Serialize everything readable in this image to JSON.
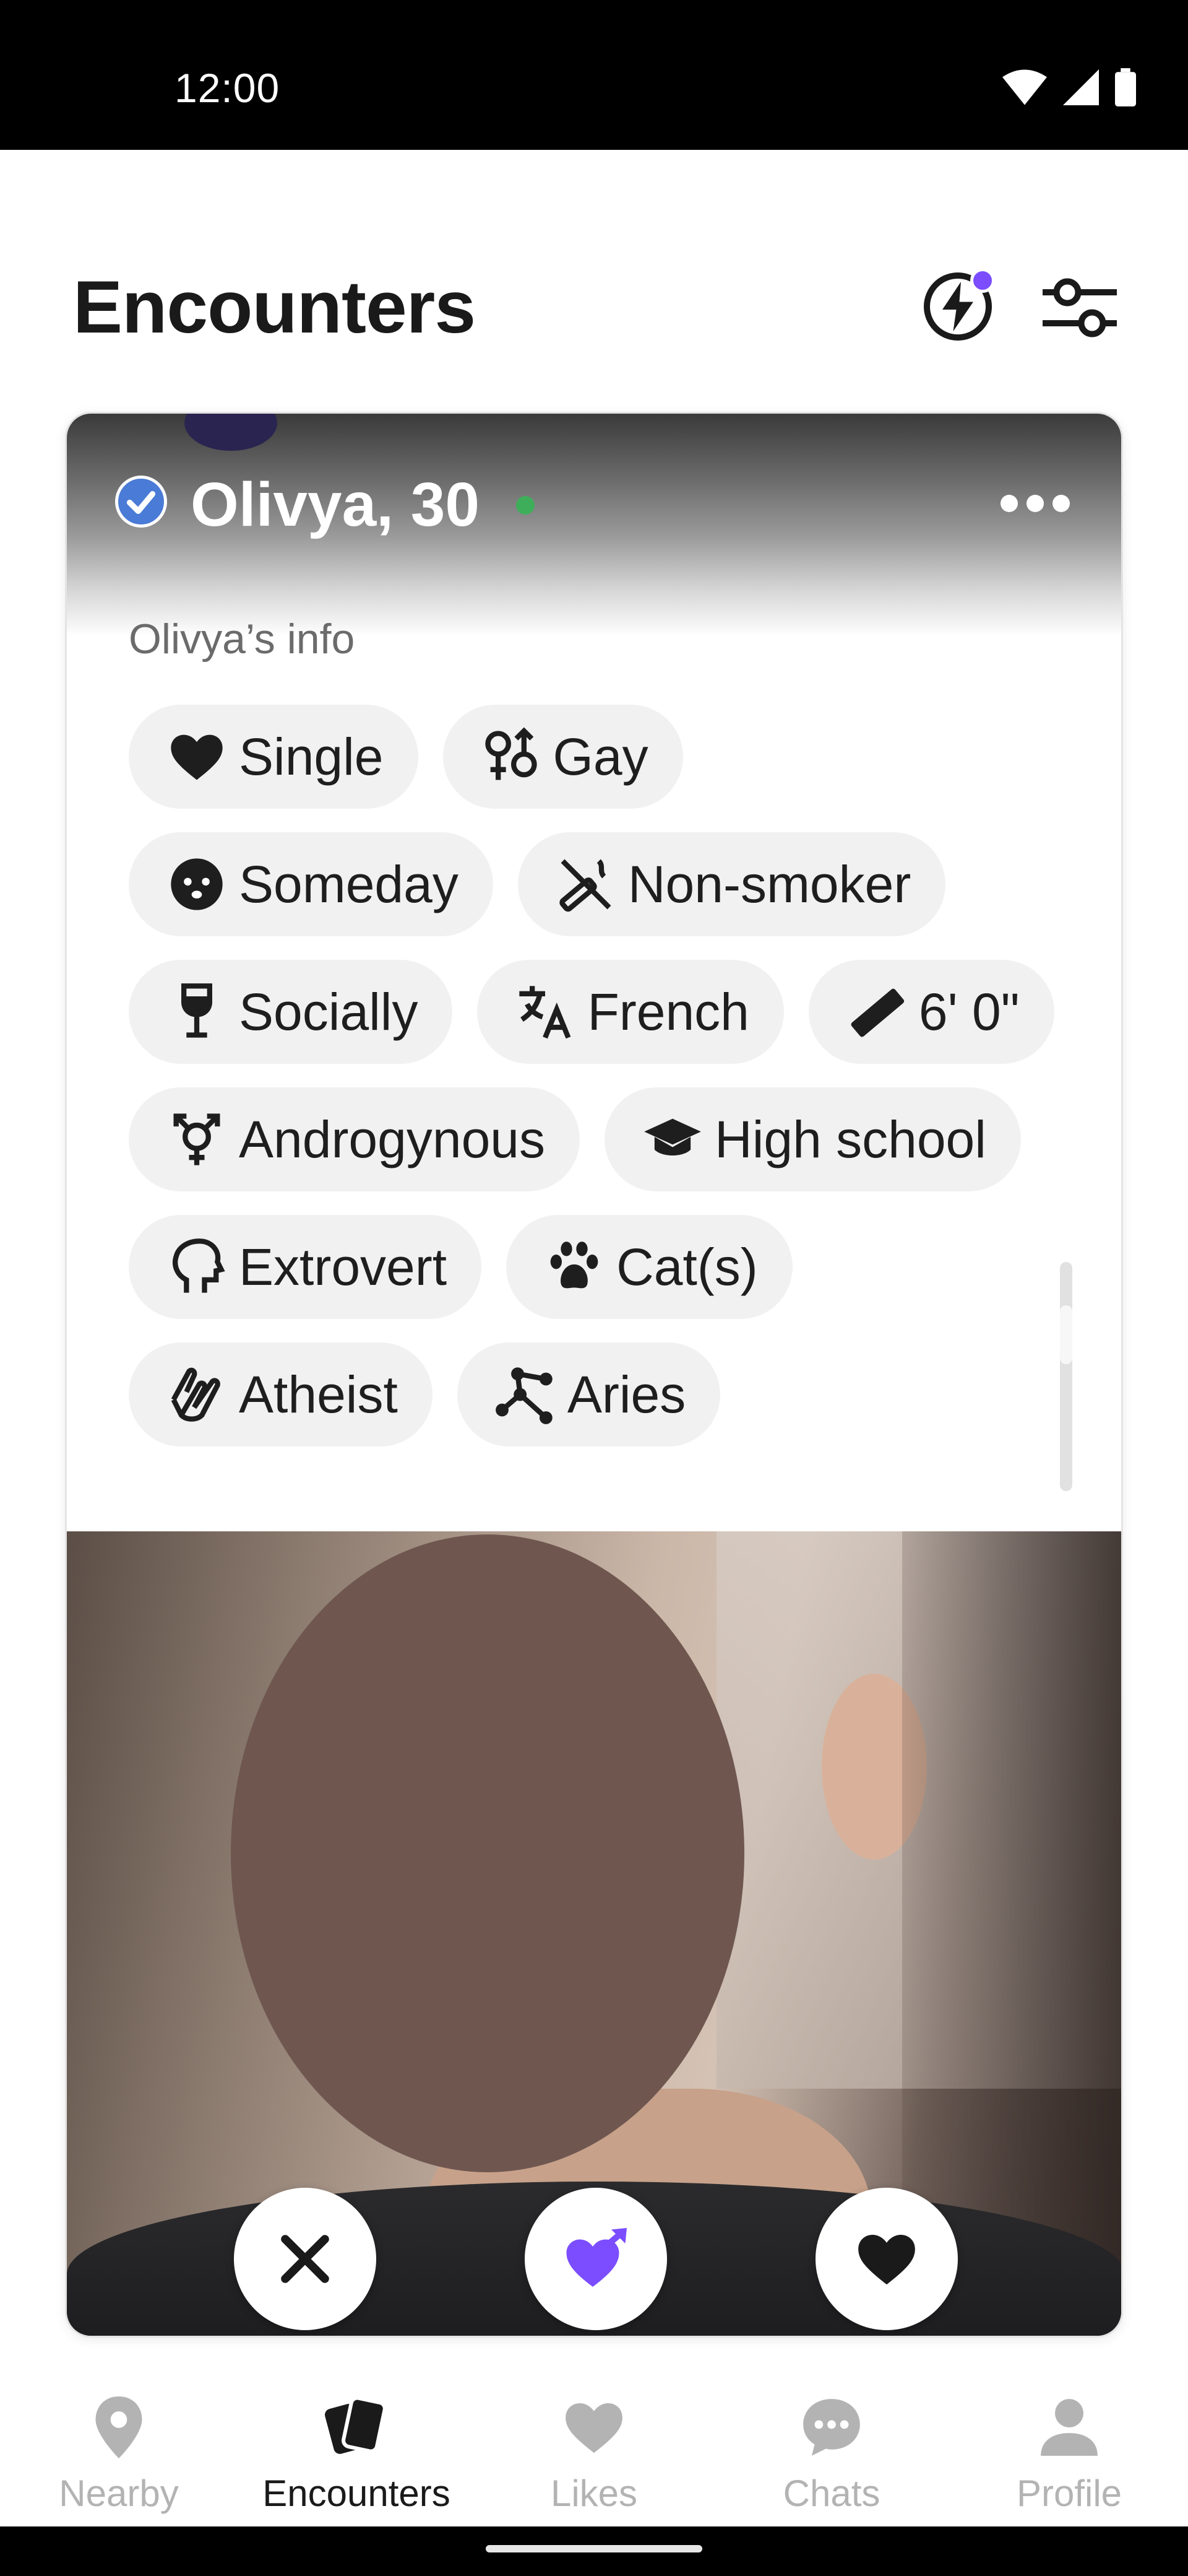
{
  "status_bar": {
    "time": "12:00",
    "icons": [
      "wifi-icon",
      "cell-signal-icon",
      "battery-icon"
    ]
  },
  "header": {
    "title": "Encounters",
    "boost_icon": "lightning-boost-icon",
    "filter_icon": "filter-sliders-icon",
    "notification_color": "#7b4dff"
  },
  "profile": {
    "name_age": "Olivya, 30",
    "verified": true,
    "online": true,
    "info_title": "Olivya’s info",
    "chips": [
      [
        {
          "icon": "heart-icon",
          "label": "Single"
        },
        {
          "icon": "gender-symbols-icon",
          "label": "Gay"
        }
      ],
      [
        {
          "icon": "baby-face-icon",
          "label": "Someday"
        },
        {
          "icon": "no-smoking-icon",
          "label": "Non-smoker"
        }
      ],
      [
        {
          "icon": "wine-glass-icon",
          "label": "Socially"
        },
        {
          "icon": "translate-icon",
          "label": "French"
        },
        {
          "icon": "ruler-icon",
          "label": "6' 0\""
        }
      ],
      [
        {
          "icon": "transgender-icon",
          "label": "Androgynous"
        },
        {
          "icon": "graduation-cap-icon",
          "label": "High school"
        }
      ],
      [
        {
          "icon": "head-outline-icon",
          "label": "Extrovert"
        },
        {
          "icon": "paw-icon",
          "label": "Cat(s)"
        }
      ],
      [
        {
          "icon": "praying-hands-icon",
          "label": "Atheist"
        },
        {
          "icon": "constellation-icon",
          "label": "Aries"
        }
      ]
    ]
  },
  "actions": {
    "pass_icon": "close-icon",
    "crush_icon": "heart-arrow-icon",
    "like_icon": "heart-icon",
    "crush_color": "#7b4dff"
  },
  "bottom_nav": [
    {
      "label": "Nearby",
      "icon": "location-pin-icon",
      "active": false
    },
    {
      "label": "Encounters",
      "icon": "cards-icon",
      "active": true
    },
    {
      "label": "Likes",
      "icon": "heart-icon",
      "active": false
    },
    {
      "label": "Chats",
      "icon": "chat-bubble-icon",
      "active": false
    },
    {
      "label": "Profile",
      "icon": "person-icon",
      "active": false
    }
  ]
}
